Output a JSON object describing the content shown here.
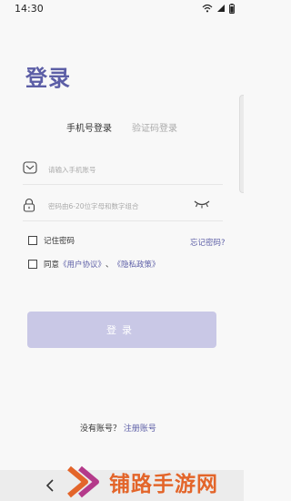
{
  "status_bar": {
    "time": "14:30",
    "icons": [
      "wifi-icon",
      "signal-icon",
      "battery-icon"
    ]
  },
  "page": {
    "title": "登录"
  },
  "tabs": [
    {
      "label": "手机号登录",
      "active": true
    },
    {
      "label": "验证码登录",
      "active": false
    }
  ],
  "form": {
    "account_placeholder": "请输入手机账号",
    "password_placeholder": "密码由6-20位字母和数字组合",
    "remember_label": "记住密码",
    "forgot_label": "忘记密码?",
    "agree_prefix": "同意",
    "user_agreement": "《用户协议》",
    "agree_sep": "、",
    "privacy_policy": "《隐私政策》",
    "login_label": "登录"
  },
  "register": {
    "prompt": "没有账号？",
    "link": "注册账号"
  },
  "watermark": {
    "text": "铺路手游网"
  },
  "colors": {
    "accent": "#5c5ea6",
    "button": "#c9c8e6",
    "watermark": "#e3652a"
  }
}
